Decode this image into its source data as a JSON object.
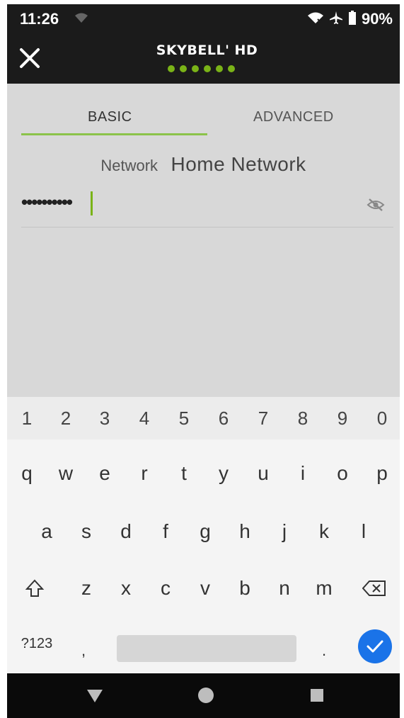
{
  "status": {
    "time": "11:26",
    "battery": "90%"
  },
  "header": {
    "brand": "SKYBELL' HD",
    "progress_steps": 6
  },
  "tabs": [
    {
      "label": "BASIC",
      "active": true
    },
    {
      "label": "ADVANCED",
      "active": false
    }
  ],
  "network": {
    "label": "Network",
    "name": "Home Network"
  },
  "password": {
    "value": "••••••••••"
  },
  "keyboard": {
    "numbers": [
      "1",
      "2",
      "3",
      "4",
      "5",
      "6",
      "7",
      "8",
      "9",
      "0"
    ],
    "row1": [
      "q",
      "w",
      "e",
      "r",
      "t",
      "y",
      "u",
      "i",
      "o",
      "p"
    ],
    "row2": [
      "a",
      "s",
      "d",
      "f",
      "g",
      "h",
      "j",
      "k",
      "l"
    ],
    "row3": [
      "z",
      "x",
      "c",
      "v",
      "b",
      "n",
      "m"
    ],
    "symbols_label": "?123",
    "comma": ",",
    "period": "."
  },
  "colors": {
    "accent": "#7ab317",
    "enter": "#1a73e8",
    "bar": "#1b1b1b"
  }
}
